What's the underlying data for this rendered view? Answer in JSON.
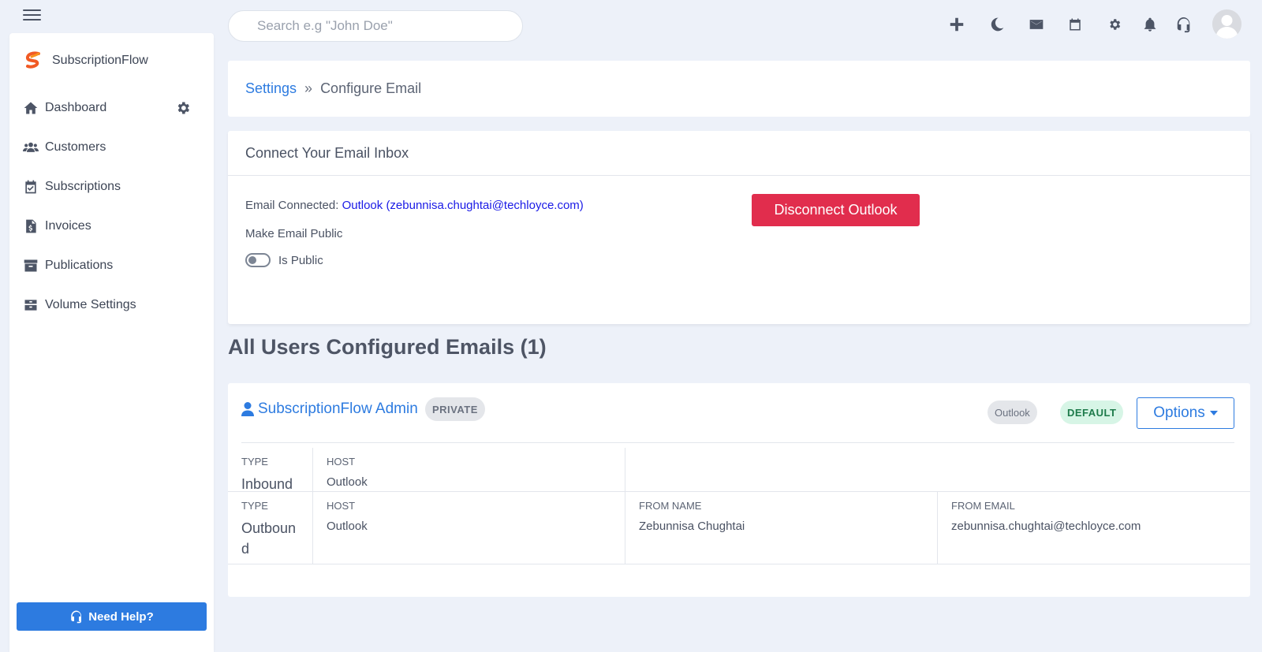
{
  "topbar": {
    "search_placeholder": "Search e.g \"John Doe\"",
    "icons": [
      "plus-icon",
      "moon-icon",
      "mail-icon",
      "calendar-icon",
      "gear-icon",
      "bell-icon",
      "headset-icon"
    ]
  },
  "sidebar": {
    "brand": "SubscriptionFlow",
    "items": [
      {
        "label": "Dashboard",
        "icon": "home-icon"
      },
      {
        "label": "Customers",
        "icon": "users-icon"
      },
      {
        "label": "Subscriptions",
        "icon": "calendar-check-icon"
      },
      {
        "label": "Invoices",
        "icon": "invoice-icon"
      },
      {
        "label": "Publications",
        "icon": "archive-icon"
      },
      {
        "label": "Volume Settings",
        "icon": "box-icon"
      }
    ],
    "help_label": "Need Help?"
  },
  "breadcrumb": {
    "parent": "Settings",
    "separator": "»",
    "current": "Configure Email"
  },
  "connect": {
    "title": "Connect Your Email Inbox",
    "connected_label": "Email Connected:",
    "connected_value": "Outlook (zebunnisa.chughtai@techloyce.com)",
    "make_public_label": "Make Email Public",
    "toggle_label": "Is Public",
    "is_public": false,
    "disconnect_label": "Disconnect Outlook"
  },
  "all_users": {
    "title": "All Users Configured Emails (1)",
    "user": {
      "name": "SubscriptionFlow Admin",
      "visibility": "PRIVATE",
      "provider_badge": "Outlook",
      "default_badge": "DEFAULT",
      "options_label": "Options"
    },
    "rows": [
      {
        "type_label": "TYPE",
        "type_value": "Inbound",
        "host_label": "HOST",
        "host_value": "Outlook"
      },
      {
        "type_label": "TYPE",
        "type_value": "Outbound",
        "host_label": "HOST",
        "host_value": "Outlook",
        "from_name_label": "FROM NAME",
        "from_name_value": "Zebunnisa Chughtai",
        "from_email_label": "FROM EMAIL",
        "from_email_value": "zebunnisa.chughtai@techloyce.com"
      }
    ]
  },
  "colors": {
    "primary": "#2d7be0",
    "danger": "#e12d4d",
    "background": "#edf1f9",
    "success_badge": "#d7f5e6"
  }
}
